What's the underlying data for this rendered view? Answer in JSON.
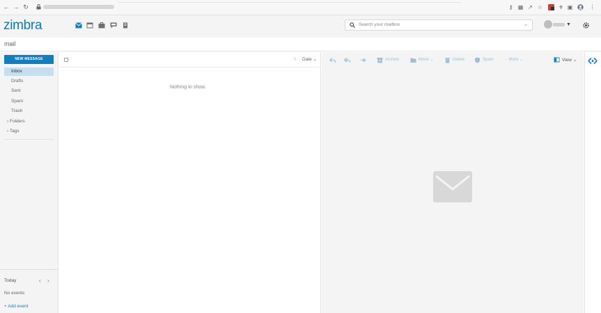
{
  "app": {
    "logo_text": "zimbra",
    "module_title": "mail",
    "brand_color": "#0f7fbf"
  },
  "header": {
    "search_placeholder": "Search your mailbox"
  },
  "app_icons": [
    "mail-icon",
    "calendar-icon",
    "briefcase-icon",
    "chat-icon",
    "notebook-icon"
  ],
  "sidebar": {
    "new_message_label": "NEW MESSAGE",
    "folders": [
      "Inbox",
      "Drafts",
      "Sent",
      "Spam",
      "Trash"
    ],
    "selected_folder": "Inbox",
    "expandables": [
      "Folders",
      "Tags"
    ],
    "calendar": {
      "today_label": "Today",
      "no_events": "No events",
      "add_event": "Add event"
    }
  },
  "message_list": {
    "sort_label": "Date",
    "empty_text": "Nothing to show."
  },
  "reading_pane": {
    "toolbar": {
      "archive": "Archive",
      "move": "Move",
      "delete": "Delete",
      "spam": "Spam",
      "more": "More",
      "view": "View"
    }
  }
}
